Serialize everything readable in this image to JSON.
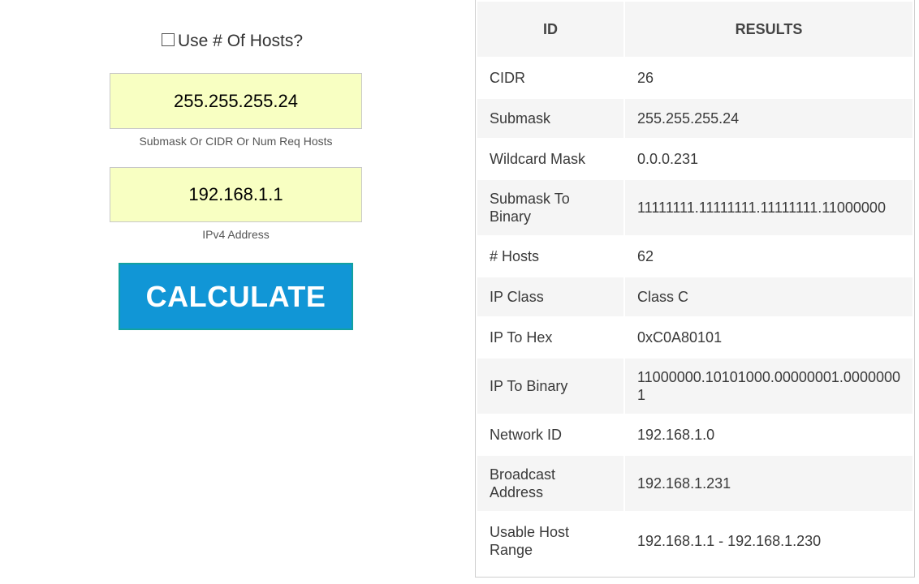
{
  "form": {
    "use_hosts_label": "Use # Of Hosts?",
    "use_hosts_checked": false,
    "submask_value": "255.255.255.24",
    "submask_caption": "Submask Or CIDR Or Num Req Hosts",
    "ip_value": "192.168.1.1",
    "ip_caption": "IPv4 Address",
    "calculate_label": "CALCULATE"
  },
  "results": {
    "headers": [
      "ID",
      "RESULTS"
    ],
    "rows": [
      {
        "id": "CIDR",
        "value": "26"
      },
      {
        "id": "Submask",
        "value": "255.255.255.24"
      },
      {
        "id": "Wildcard Mask",
        "value": "0.0.0.231"
      },
      {
        "id": "Submask To Binary",
        "value": "11111111.11111111.11111111.11000000"
      },
      {
        "id": "# Hosts",
        "value": "62"
      },
      {
        "id": "IP Class",
        "value": "Class C"
      },
      {
        "id": "IP To Hex",
        "value": "0xC0A80101"
      },
      {
        "id": "IP To Binary",
        "value": "11000000.10101000.00000001.00000001"
      },
      {
        "id": "Network ID",
        "value": "192.168.1.0"
      },
      {
        "id": "Broadcast Address",
        "value": "192.168.1.231"
      },
      {
        "id": "Usable Host Range",
        "value": "192.168.1.1 - 192.168.1.230"
      }
    ]
  },
  "colors": {
    "input_bg": "#f8ffc2",
    "button_bg": "#1196d6",
    "button_border": "#12a1a0",
    "row_alt": "#f5f5f5"
  }
}
